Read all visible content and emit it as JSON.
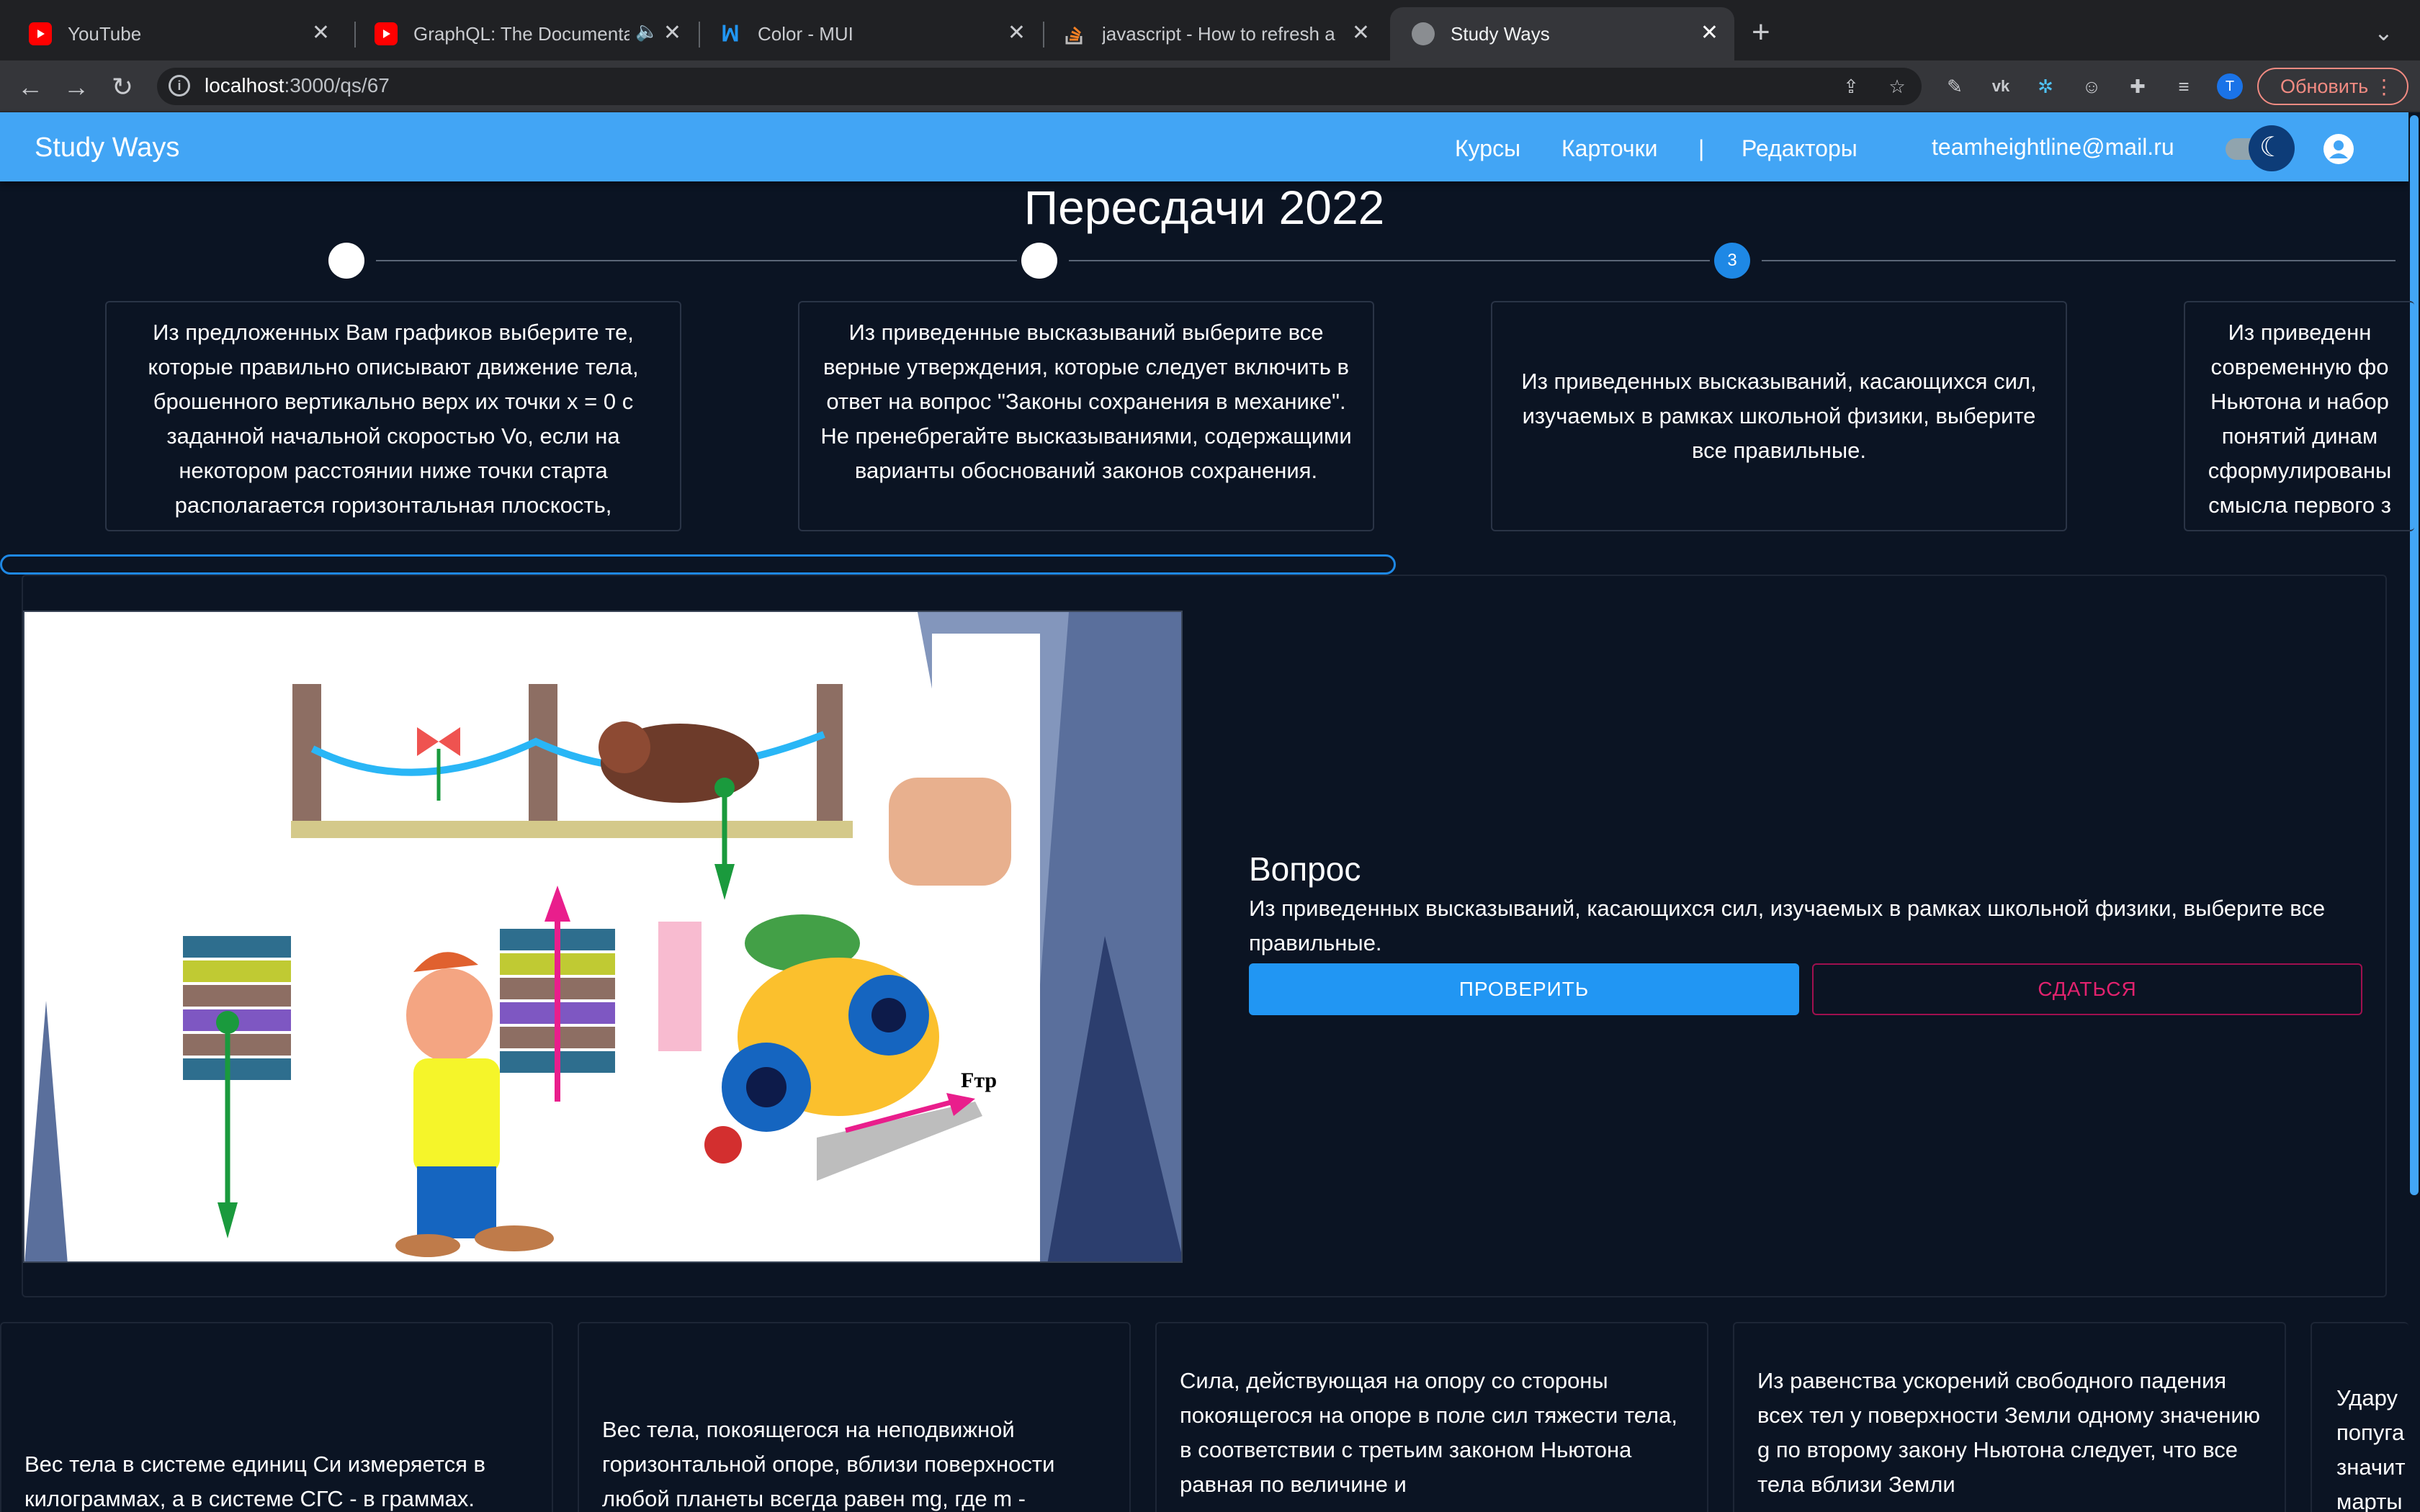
{
  "browser": {
    "tabs": [
      {
        "title": "YouTube",
        "icon": "youtube-icon"
      },
      {
        "title": "GraphQL: The Documentary",
        "icon": "youtube-icon"
      },
      {
        "title": "Color - MUI",
        "icon": "mui-icon"
      },
      {
        "title": "javascript - How to refresh a Page",
        "icon": "stackoverflow-icon"
      },
      {
        "title": "Study Ways",
        "icon": "globe-icon"
      }
    ],
    "url_host": "localhost",
    "url_path": ":3000/qs/67",
    "profile_initial": "T",
    "update_label": "Обновить"
  },
  "app": {
    "brand": "Study Ways",
    "nav": {
      "courses": "Курсы",
      "cards": "Карточки",
      "separator": "|",
      "editors": "Редакторы"
    },
    "user_email": "teamheightline@mail.ru",
    "accent": "#42a5f5"
  },
  "page": {
    "title": "Пересдачи 2022",
    "active_step": "3"
  },
  "questions": [
    "Из предложенных Вам графиков выберите те, которые правильно описывают движение тела, брошенного вертикально верх их точки x = 0 с заданной начальной скоростью Vo, если на некотором расстоянии ниже точки старта располагается горизонтальная плоскость,",
    "Из приведенные высказываний выберите все верные утверждения, которые следует включить в ответ на вопрос \"Законы сохранения в механике\". Не пренебрегайте высказываниями, содержащими варианты обоснований законов сохранения.",
    "Из приведенных высказываний, касающихся сил, изучаемых в рамках школьной физики, выберите все правильные.",
    "Из приведенн современную фо Ньютона и набор понятий динам сформулированы смысла первого з"
  ],
  "current": {
    "heading": "Вопрос",
    "text": "Из приведенных высказываний, касающихся сил, изучаемых в рамках школьной физики, выберите все правильные.",
    "check_label": "ПРОВЕРИТЬ",
    "give_up_label": "СДАТЬСЯ",
    "image_label": "Fтр"
  },
  "answers": [
    "Вес тела в системе единиц Си измеряется в килограммах, а в системе СГС - в граммах.",
    "Вес тела, покоящегося на неподвижной горизонтальной опоре, вблизи поверхности любой планеты всегда равен mg, где m -",
    "Сила, действующая на опору со стороны покоящегося на опоре в поле сил тяжести тела, в соответствии с третьим законом Ньютона равная по величине и",
    "Из равенства ускорений свободного падения всех тел у поверхности Земли одному значению g по второму закону Ньютона следует, что все тела вблизи Земли",
    "Удару попуга значит марты"
  ]
}
